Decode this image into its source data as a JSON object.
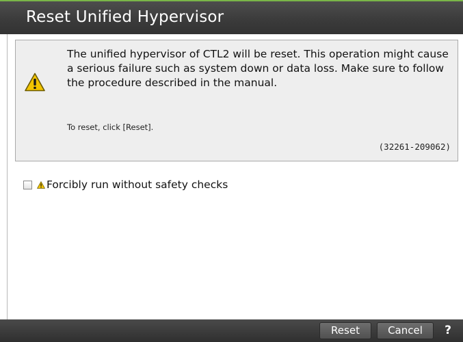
{
  "dialog": {
    "title": "Reset Unified Hypervisor"
  },
  "message": {
    "text": "The unified hypervisor of CTL2 will be reset. This operation might cause a serious failure such as system down or data loss. Make sure to follow the procedure described in the manual.",
    "instruction": "To reset, click [Reset].",
    "code": "(32261-209062)",
    "icon": "warning-triangle-icon"
  },
  "options": {
    "force_label": "Forcibly run without safety checks",
    "force_checked": false,
    "icon": "warning-triangle-small-icon"
  },
  "footer": {
    "reset_label": "Reset",
    "cancel_label": "Cancel",
    "help_label": "?"
  },
  "colors": {
    "titlebar": "#3f3f3f",
    "accent_line": "#7ab648",
    "message_bg": "#eeeeee",
    "warning_yellow": "#f2c400"
  }
}
